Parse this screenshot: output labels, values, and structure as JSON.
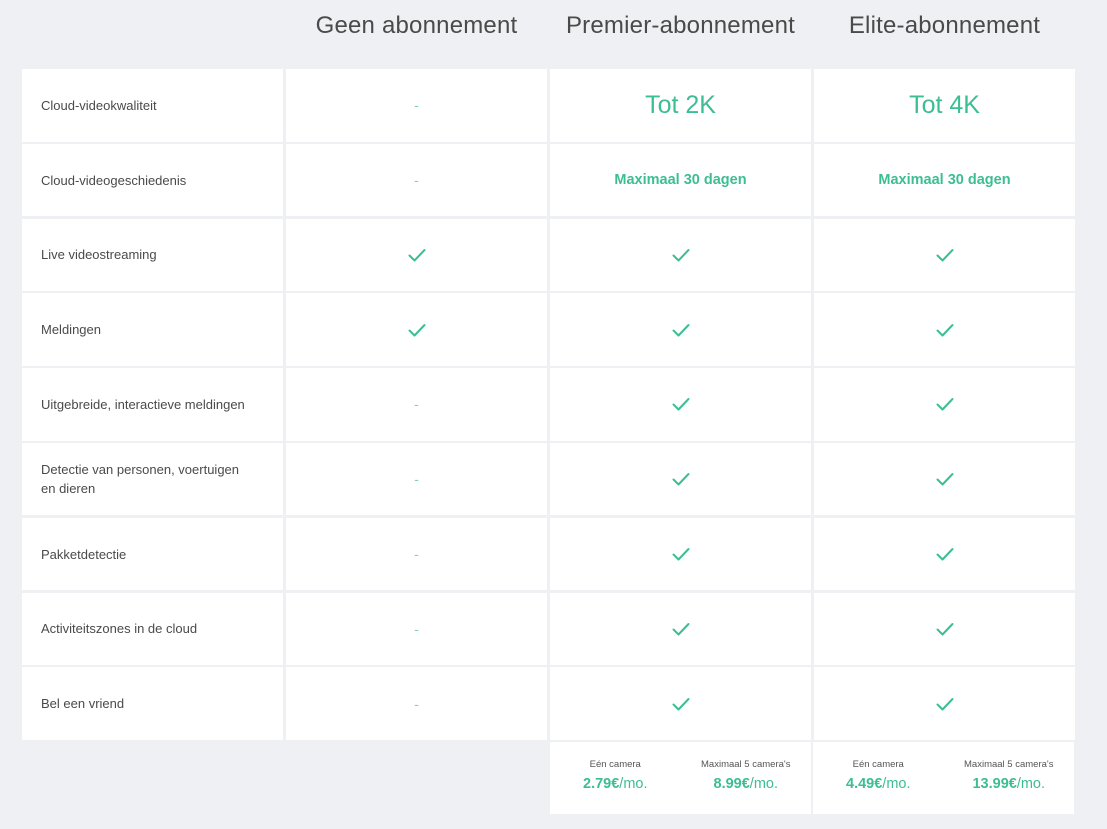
{
  "plans": [
    {
      "name": "Geen abonnement"
    },
    {
      "name": "Premier-abonnement"
    },
    {
      "name": "Elite-abonnement"
    }
  ],
  "rows": [
    {
      "feature": "Cloud-videokwaliteit",
      "values": [
        {
          "type": "dash",
          "text": "-"
        },
        {
          "type": "big",
          "text": "Tot 2K"
        },
        {
          "type": "big",
          "text": "Tot 4K"
        }
      ]
    },
    {
      "feature": "Cloud-videogeschiedenis",
      "values": [
        {
          "type": "dash",
          "text": "-"
        },
        {
          "type": "mid",
          "text": "Maximaal 30 dagen"
        },
        {
          "type": "mid",
          "text": "Maximaal 30 dagen"
        }
      ]
    },
    {
      "feature": "Live videostreaming",
      "values": [
        {
          "type": "check"
        },
        {
          "type": "check"
        },
        {
          "type": "check"
        }
      ]
    },
    {
      "feature": "Meldingen",
      "values": [
        {
          "type": "check"
        },
        {
          "type": "check"
        },
        {
          "type": "check"
        }
      ]
    },
    {
      "feature": "Uitgebreide, interactieve meldingen",
      "values": [
        {
          "type": "dash",
          "text": "-"
        },
        {
          "type": "check"
        },
        {
          "type": "check"
        }
      ]
    },
    {
      "feature": "Detectie van personen, voertuigen en dieren",
      "values": [
        {
          "type": "dash",
          "text": "-"
        },
        {
          "type": "check"
        },
        {
          "type": "check"
        }
      ]
    },
    {
      "feature": "Pakketdetectie",
      "values": [
        {
          "type": "dash",
          "text": "-"
        },
        {
          "type": "check"
        },
        {
          "type": "check"
        }
      ]
    },
    {
      "feature": "Activiteitszones in de cloud",
      "values": [
        {
          "type": "dash",
          "text": "-"
        },
        {
          "type": "check"
        },
        {
          "type": "check"
        }
      ]
    },
    {
      "feature": "Bel een vriend",
      "values": [
        {
          "type": "dash",
          "text": "-"
        },
        {
          "type": "check"
        },
        {
          "type": "check"
        }
      ]
    }
  ],
  "pricing": {
    "premier": [
      {
        "label": "Eén camera",
        "amount": "2.79€",
        "unit": "/mo."
      },
      {
        "label": "Maximaal 5 camera's",
        "amount": "8.99€",
        "unit": "/mo."
      }
    ],
    "elite": [
      {
        "label": "Eén camera",
        "amount": "4.49€",
        "unit": "/mo."
      },
      {
        "label": "Maximaal 5 camera's",
        "amount": "13.99€",
        "unit": "/mo."
      }
    ]
  },
  "colors": {
    "accent": "#3cbe94",
    "background": "#eef0f3",
    "cell": "#ffffff"
  },
  "icons": {
    "check": "checkmark-icon"
  }
}
